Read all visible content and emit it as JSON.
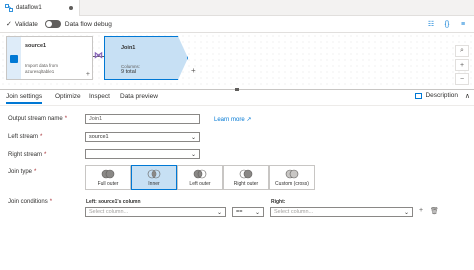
{
  "tab": {
    "title": "dataflow1"
  },
  "toolbar": {
    "validate": "Validate",
    "debug": "Data flow debug"
  },
  "source_node": {
    "title": "source1",
    "subtitle_line1": "Import data from",
    "subtitle_line2": "azuresqltable1"
  },
  "join_node": {
    "title": "Join1",
    "columns_label": "Columns:",
    "columns_value": "9 total"
  },
  "panel_tabs": [
    "Join settings",
    "Optimize",
    "Inspect",
    "Data preview"
  ],
  "description_label": "Description",
  "form": {
    "output_stream_label": "Output stream name",
    "output_stream_value": "Join1",
    "learn_more": "Learn more",
    "left_stream_label": "Left stream",
    "left_stream_value": "source1",
    "right_stream_label": "Right stream",
    "right_stream_value": "",
    "join_type_label": "Join type",
    "join_types": [
      "Full outer",
      "Inner",
      "Left outer",
      "Right outer",
      "Custom (cross)"
    ],
    "selected_join_type": "Inner",
    "join_conditions_label": "Join conditions",
    "left_column_header": "Left: source1's column",
    "right_column_header": "Right:",
    "left_column_placeholder": "Select column...",
    "operator_value": "==",
    "right_column_placeholder": "Select column..."
  },
  "colors": {
    "accent": "#0078d4",
    "join_node_fill": "#c7e0f4",
    "required": "#a4262c"
  }
}
